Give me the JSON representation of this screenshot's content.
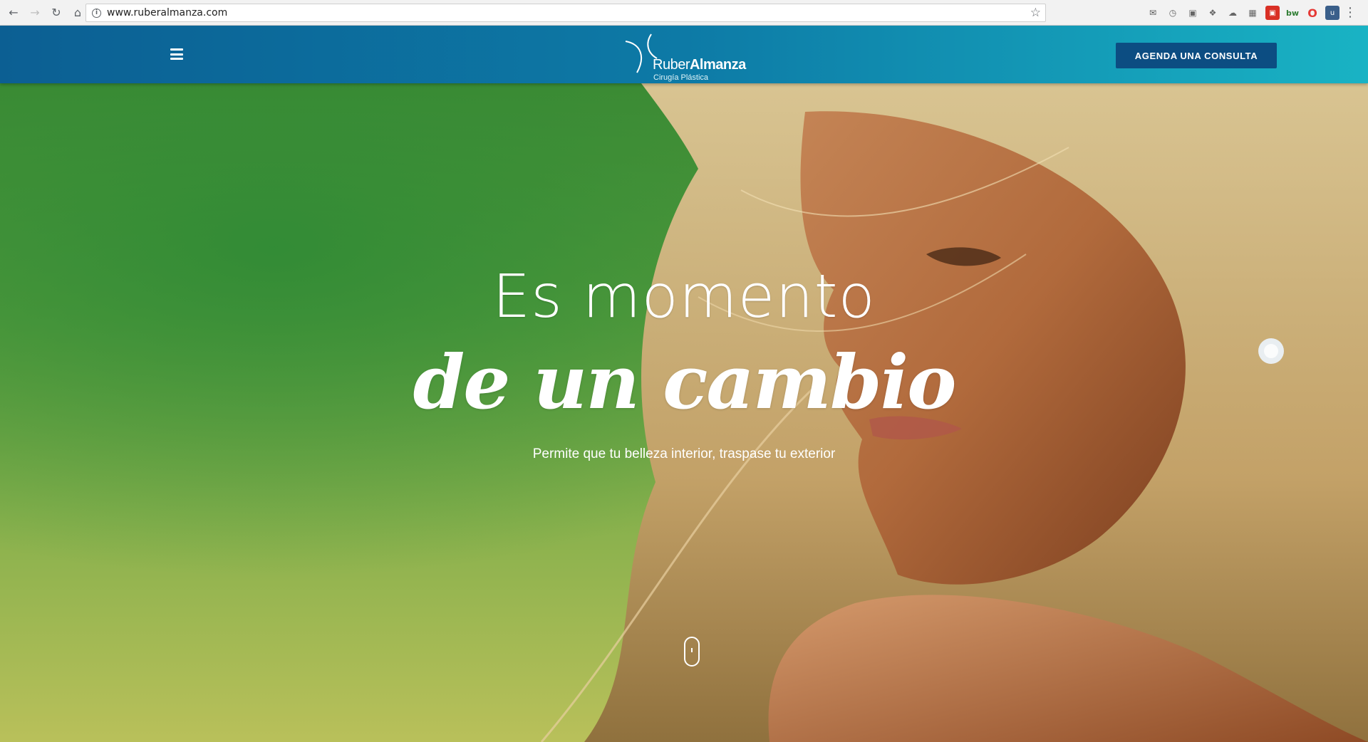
{
  "browser": {
    "url": "www.ruberalmanza.com",
    "back_icon": "arrow-left-icon",
    "forward_icon": "arrow-right-icon",
    "reload_icon": "reload-icon",
    "home_icon": "home-icon",
    "info_icon": "info-icon",
    "star_icon": "star-icon"
  },
  "header": {
    "logo_first": "Ruber",
    "logo_second": "Almanza",
    "logo_subtitle": "Cirugía Plástica",
    "cta_label": "AGENDA UNA CONSULTA",
    "menu_icon": "hamburger-menu-icon"
  },
  "hero": {
    "headline": "Es momento",
    "script": "de un cambio",
    "subtitle": "Permite que tu belleza interior, traspase tu exterior"
  },
  "colors": {
    "header_start": "#0c5f93",
    "header_end": "#19b3c4",
    "cta_bg": "#0c4d82",
    "hero_green": "#4a9a3a",
    "hero_yellow": "#b9c05a"
  }
}
